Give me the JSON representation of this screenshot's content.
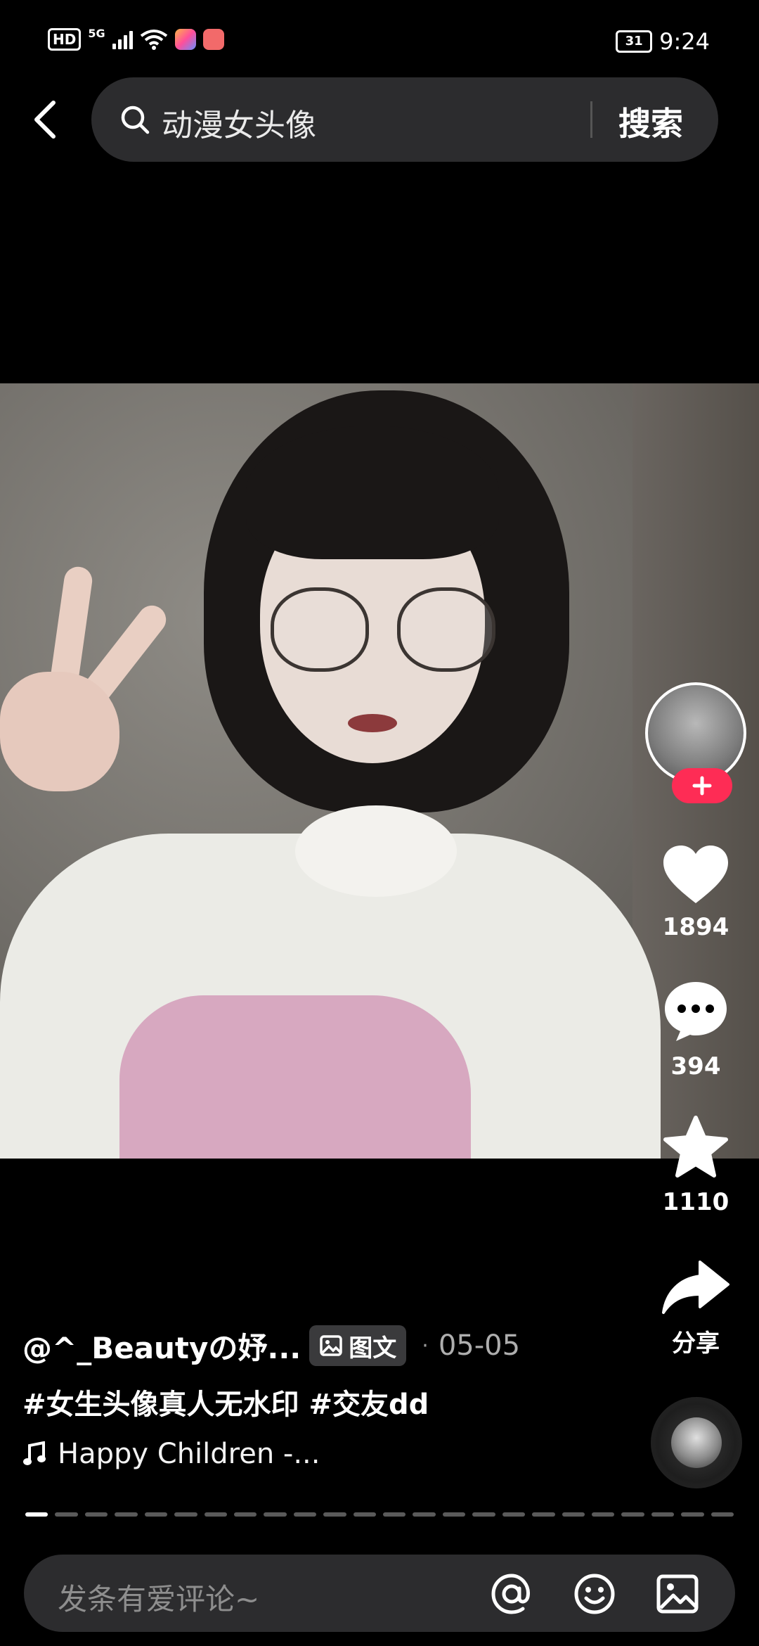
{
  "status_bar": {
    "hd": "HD",
    "network": "5G",
    "battery": "31",
    "time": "9:24"
  },
  "search": {
    "query": "动漫女头像",
    "button": "搜索"
  },
  "post": {
    "author": "@^_Beautyの妤...",
    "type_label": "图文",
    "separator": "·",
    "date": "05-05",
    "hashtags": "#女生头像真人无水印 #交友dd",
    "music": "Happy Children -..."
  },
  "actions": {
    "likes": "1894",
    "comments": "394",
    "favorites": "1110",
    "share": "分享"
  },
  "comment_bar": {
    "placeholder": "发条有爱评论~"
  },
  "carousel": {
    "pages": 24,
    "current": 1
  },
  "colors": {
    "accent": "#fe2c55",
    "background": "#000000",
    "surface": "#2c2c2e"
  }
}
